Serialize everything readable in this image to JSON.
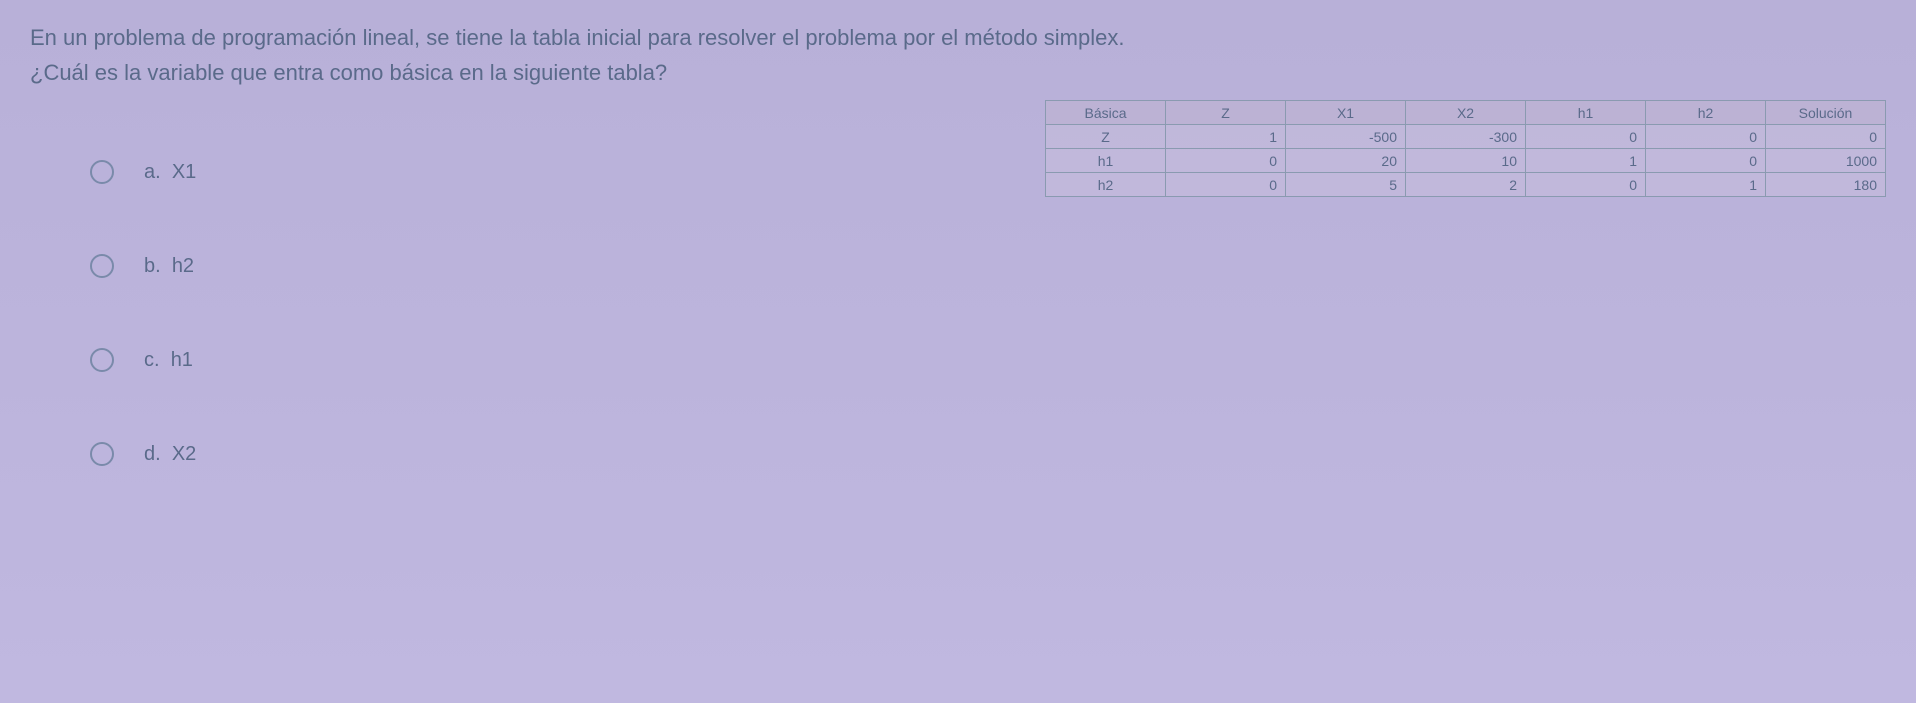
{
  "question": {
    "line1": "En un problema de programación lineal, se tiene la tabla inicial para resolver el problema por el método simplex.",
    "line2": "¿Cuál es la variable que entra como básica en la siguiente tabla?"
  },
  "options": {
    "a": {
      "prefix": "a.",
      "value": "X1"
    },
    "b": {
      "prefix": "b.",
      "value": "h2"
    },
    "c": {
      "prefix": "c.",
      "value": "h1"
    },
    "d": {
      "prefix": "d.",
      "value": "X2"
    }
  },
  "chart_data": {
    "type": "table",
    "headers": [
      "Básica",
      "Z",
      "X1",
      "X2",
      "h1",
      "h2",
      "Solución"
    ],
    "rows": [
      [
        "Z",
        "1",
        "-500",
        "-300",
        "0",
        "0",
        "0"
      ],
      [
        "h1",
        "0",
        "20",
        "10",
        "1",
        "0",
        "1000"
      ],
      [
        "h2",
        "0",
        "5",
        "2",
        "0",
        "1",
        "180"
      ]
    ]
  }
}
